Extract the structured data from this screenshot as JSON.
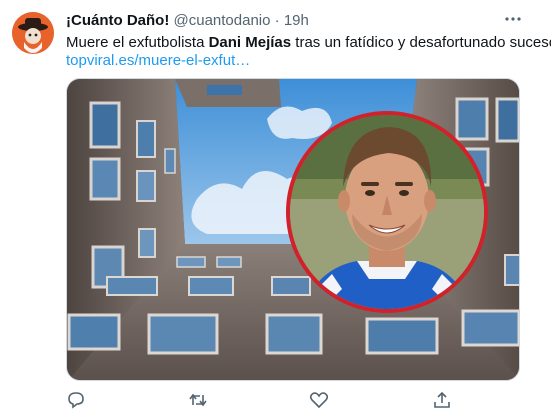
{
  "tweet": {
    "display_name": "¡Cuánto Daño!",
    "handle": "@cuantodanio",
    "separator": "·",
    "time": "19h",
    "text_before": "Muere el exfutbolista ",
    "text_bold": "Dani Mejías",
    "text_after": " tras un fatídico y desafortunado suceso",
    "link": "topviral.es/muere-el-exfut…"
  },
  "icons": {
    "avatar": "avatar-icon",
    "more": "more-icon",
    "reply": "reply-icon",
    "retweet": "retweet-icon",
    "like": "like-icon",
    "share": "share-icon"
  },
  "colors": {
    "link": "#1d9bf0",
    "secondary_text": "#536471",
    "avatar_bg": "#e8622c",
    "portrait_ring": "#d1212a"
  }
}
